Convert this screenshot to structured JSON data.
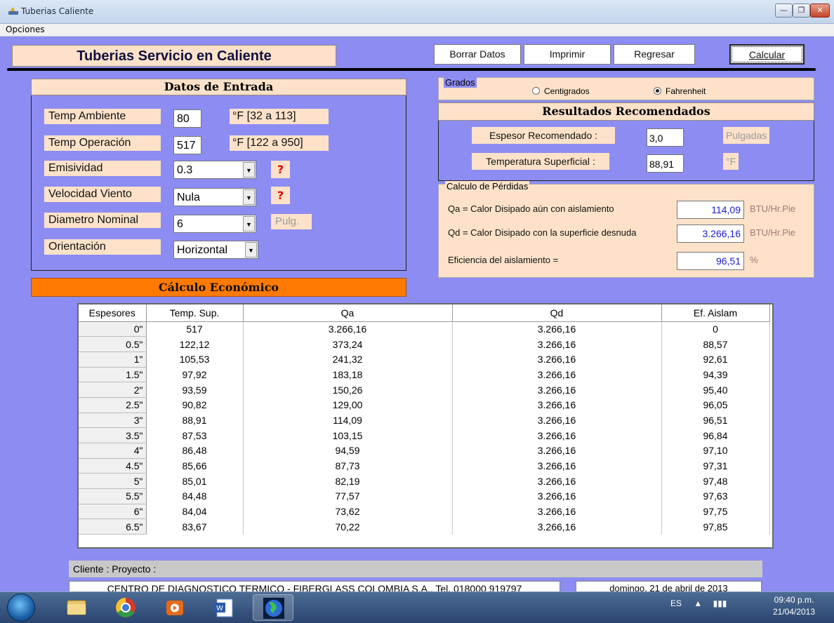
{
  "window": {
    "title": "Tuberias Caliente",
    "minimize": "—",
    "maximize": "❐",
    "close": "✕"
  },
  "menu": {
    "opciones": "Opciones"
  },
  "header": {
    "title": "Tuberias Servicio en Caliente",
    "buttons": {
      "borrar": "Borrar Datos",
      "imprimir": "Imprimir",
      "regresar": "Regresar",
      "calcular": "Calcular"
    }
  },
  "datos": {
    "title": "Datos de Entrada",
    "temp_ambiente": {
      "label": "Temp Ambiente",
      "value": "80",
      "range": "°F  [32 a 113]"
    },
    "temp_operacion": {
      "label": "Temp Operación",
      "value": "517",
      "range": "°F  [122 a 950]"
    },
    "emisividad": {
      "label": "Emisividad",
      "value": "0.3",
      "help": "?"
    },
    "velocidad_viento": {
      "label": "Velocidad  Viento",
      "value": "Nula",
      "help": "?"
    },
    "diametro_nominal": {
      "label": "Diametro Nominal",
      "value": "6",
      "unit": "Pulg."
    },
    "orientacion": {
      "label": "Orientación",
      "value": "Horizontal"
    }
  },
  "calculo_economico_title": "Cálculo Económico",
  "grados": {
    "legend": "Grados",
    "centigrados": "Centigrados",
    "fahrenheit": "Fahrenheit",
    "selected": "fahrenheit"
  },
  "resultados": {
    "title": "Resultados Recomendados",
    "espesor_label": "Espesor Recomendado :",
    "espesor_value": "3,0",
    "espesor_unit": "Pulgadas",
    "temp_label": "Temperatura Superficial :",
    "temp_value": "88,91",
    "temp_unit": "°F"
  },
  "perdidas": {
    "legend": "Calculo de Pérdidas",
    "qa_label": "Qa = Calor Disipado aún con aislamiento",
    "qa_value": "114,09",
    "qa_unit": "BTU/Hr.Pie",
    "qd_label": "Qd = Calor Disipado con la superficie desnuda",
    "qd_value": "3.266,16",
    "qd_unit": "BTU/Hr.Pie",
    "ef_label": "Eficiencia del aislamiento =",
    "ef_value": "96,51",
    "ef_unit": "%"
  },
  "table": {
    "headers": [
      "Espesores",
      "Temp. Sup.",
      "Qa",
      "Qd",
      "Ef. Aislam"
    ],
    "rows": [
      [
        "0\"",
        "517",
        "3.266,16",
        "3.266,16",
        "0"
      ],
      [
        "0.5\"",
        "122,12",
        "373,24",
        "3.266,16",
        "88,57"
      ],
      [
        "1\"",
        "105,53",
        "241,32",
        "3.266,16",
        "92,61"
      ],
      [
        "1.5\"",
        "97,92",
        "183,18",
        "3.266,16",
        "94,39"
      ],
      [
        "2\"",
        "93,59",
        "150,26",
        "3.266,16",
        "95,40"
      ],
      [
        "2.5\"",
        "90,82",
        "129,00",
        "3.266,16",
        "96,05"
      ],
      [
        "3\"",
        "88,91",
        "114,09",
        "3.266,16",
        "96,51"
      ],
      [
        "3.5\"",
        "87,53",
        "103,15",
        "3.266,16",
        "96,84"
      ],
      [
        "4\"",
        "86,48",
        "94,59",
        "3.266,16",
        "97,10"
      ],
      [
        "4.5\"",
        "85,66",
        "87,73",
        "3.266,16",
        "97,31"
      ],
      [
        "5\"",
        "85,01",
        "82,19",
        "3.266,16",
        "97,48"
      ],
      [
        "5.5\"",
        "84,48",
        "77,57",
        "3.266,16",
        "97,63"
      ],
      [
        "6\"",
        "84,04",
        "73,62",
        "3.266,16",
        "97,75"
      ],
      [
        "6.5\"",
        "83,67",
        "70,22",
        "3.266,16",
        "97,85"
      ]
    ]
  },
  "footer": {
    "cliente": "Cliente :   Proyecto :",
    "company": "CENTRO DE DIAGNOSTICO TERMICO - FIBERGLASS COLOMBIA S.A., Tel. 018000 919797",
    "date": "domingo, 21 de abril de 2013"
  },
  "taskbar": {
    "lang": "ES",
    "tray_arrow": "▲",
    "time": "09:40 p.m.",
    "date": "21/04/2013",
    "icons": [
      "explorer-icon",
      "chrome-icon",
      "media-player-icon",
      "word-icon",
      "globe-app-icon"
    ]
  },
  "colors": {
    "background": "#8c8cf2",
    "panel": "#fde2c9",
    "accent_orange": "#ff7a00",
    "help_red": "#e00000"
  }
}
